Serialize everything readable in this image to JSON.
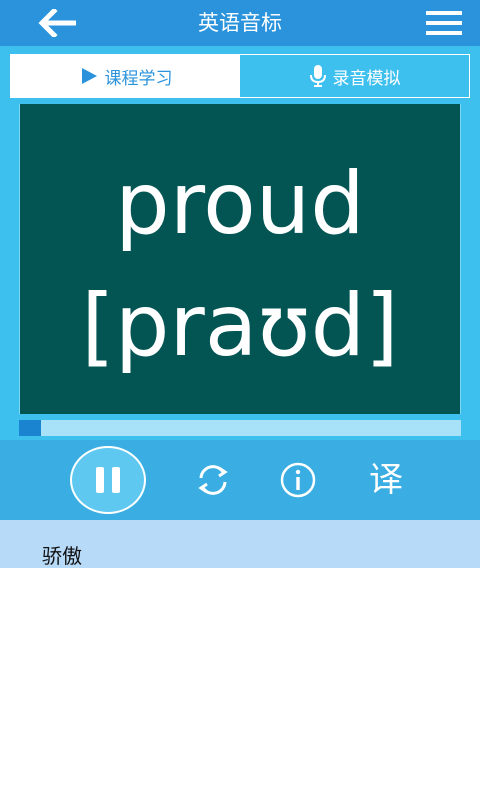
{
  "header": {
    "title": "英语音标",
    "back_icon": "arrow-left-icon",
    "menu_icon": "hamburger-menu-icon"
  },
  "tabs": [
    {
      "label": "课程学习",
      "icon": "play-icon",
      "active": true
    },
    {
      "label": "录音模拟",
      "icon": "microphone-icon",
      "active": false
    }
  ],
  "lesson": {
    "word": "proud",
    "phonetic": "[praʊd]",
    "meaning": "骄傲"
  },
  "progress": {
    "fraction": 0.05
  },
  "controls": {
    "pause_icon": "pause-icon",
    "repeat_icon": "refresh-icon",
    "info_icon": "info-icon",
    "translate_label": "译"
  },
  "colors": {
    "header": "#2a93dc",
    "panel": "#3ec0ef",
    "board": "#035554",
    "controls": "#3aaee3",
    "meaning_bar": "#b7daf9"
  }
}
